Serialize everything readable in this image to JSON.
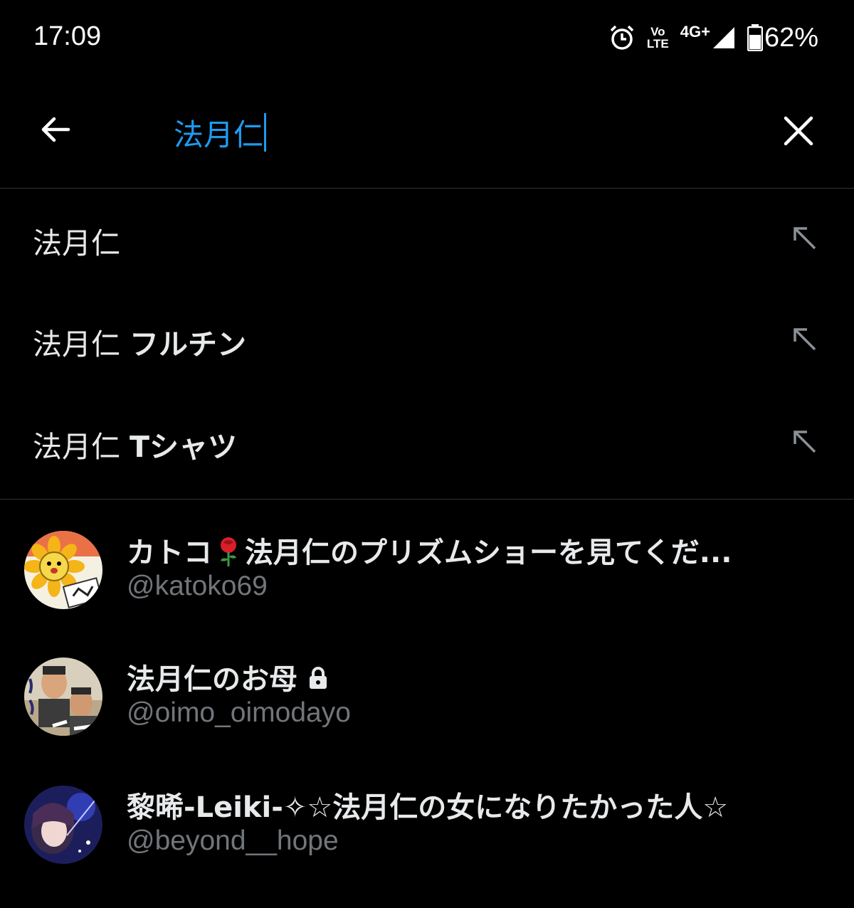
{
  "status_bar": {
    "time": "17:09",
    "volte_top": "Vo",
    "volte_bottom": "LTE",
    "network": "4G+",
    "battery": "62%",
    "icons": [
      "alarm-icon",
      "volte-icon",
      "signal-icon",
      "battery-icon"
    ]
  },
  "search": {
    "query": "法月仁",
    "back_icon": "back-arrow-icon",
    "clear_icon": "close-icon",
    "accent_color": "#1d9bf0"
  },
  "suggestions": [
    {
      "prefix": "法月仁",
      "suffix": ""
    },
    {
      "prefix": "法月仁",
      "suffix": "フルチン"
    },
    {
      "prefix": "法月仁",
      "suffix": "Tシャツ"
    }
  ],
  "users": [
    {
      "name_before": "カトコ",
      "emoji": "🌹",
      "name_after": "法月仁のプリズムショーを見てくだ...",
      "handle": "@katoko69",
      "locked": false
    },
    {
      "name_before": "法月仁のお母",
      "emoji": "",
      "name_after": "",
      "handle": "@oimo_oimodayo",
      "locked": true
    },
    {
      "name_before": "黎晞-Leiki-",
      "emoji": "✧",
      "name_after": "☆法月仁の女になりたかった人☆",
      "handle": "@beyond__hope",
      "locked": false
    }
  ]
}
